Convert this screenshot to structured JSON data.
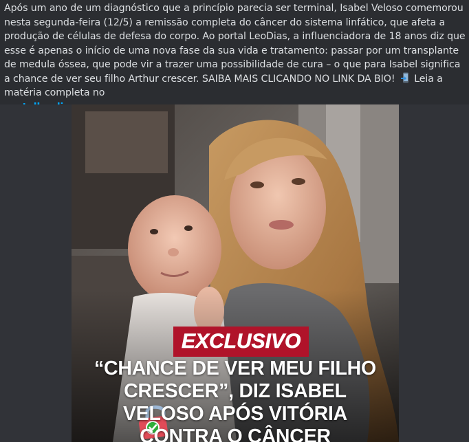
{
  "post": {
    "caption": {
      "text_main": "Após um ano de um diagnóstico que a princípio parecia ser terminal, Isabel Veloso comemorou nesta segunda-feira (12/5) a remissão completa do câncer do sistema linfático, que afeta a produção de células de defesa do corpo. Ao portal LeoDias, a influenciadora de 18 anos diz que esse é apenas o início de uma nova fase da sua vida e tratamento: passar por um transplante de medula óssea, que pode vir a trazer uma possibilidade de cura – o que para Isabel significa a chance de ver seu filho Arthur crescer. SAIBA MAIS CLICANDO NO LINK DA BIO!",
      "icon": "mobile-phone-arrow-icon",
      "text_tail": "Leia a matéria completa no",
      "link_text": "portalleodias.com",
      "link_color": "#00a8fc",
      "text_color": "#dbdee1"
    },
    "image": {
      "badge_label": "EXCLUSIVO",
      "badge_color": "#b0132a",
      "headline_lines": [
        "“CHANCE DE VER MEU FILHO",
        "CRESCER”, DIZ ISABEL",
        "VELOSO APÓS VITÓRIA",
        "CONTRA O CÂNCER"
      ],
      "lock_icon": "padlock-check-icon"
    }
  }
}
